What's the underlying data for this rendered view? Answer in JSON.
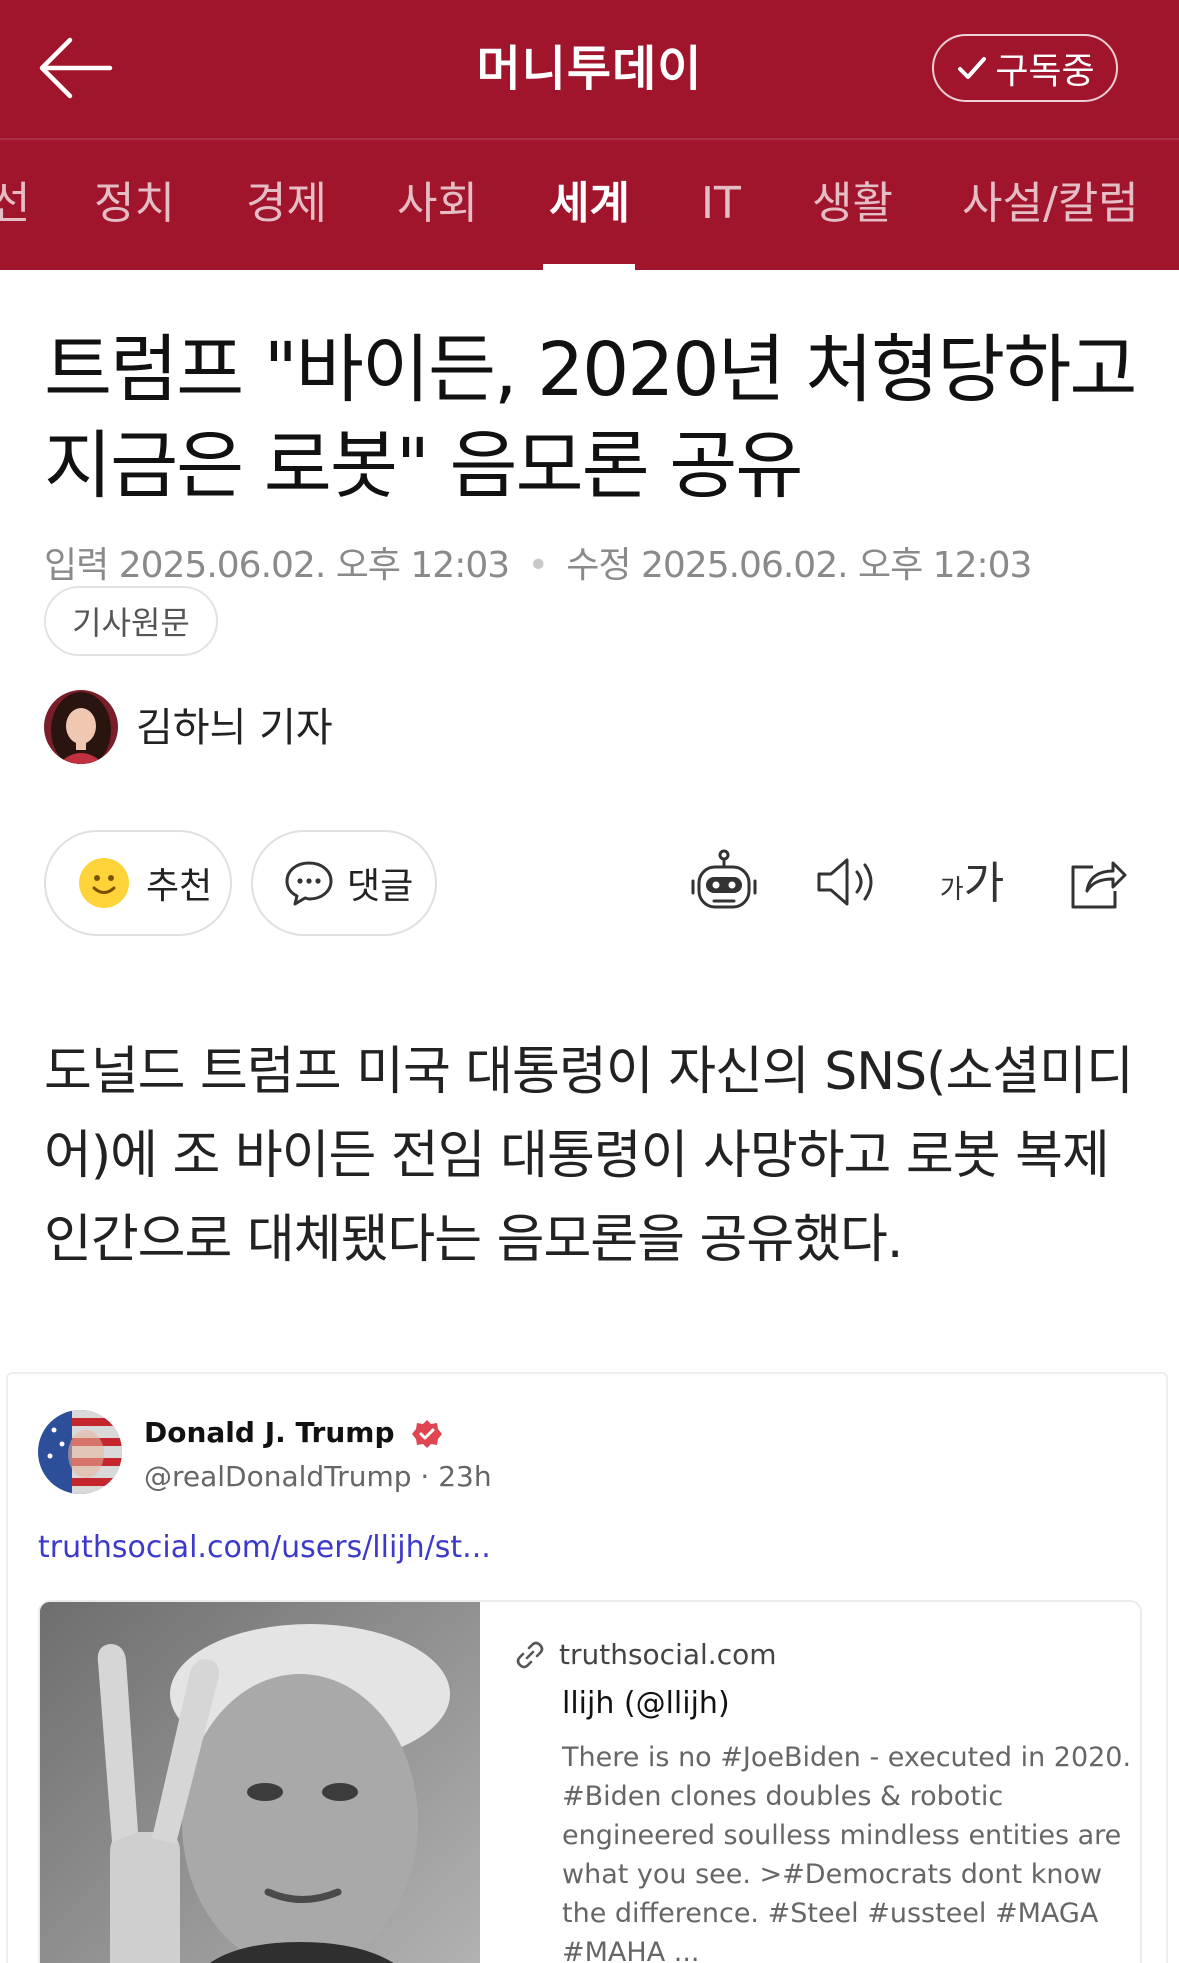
{
  "header": {
    "back_icon": "arrow-left-icon",
    "brand": "머니투데이",
    "subscribe_label": "구독중",
    "subscribe_icon": "check-icon",
    "brand_color": "#a0142c"
  },
  "tabs": [
    {
      "label": "선",
      "active": false
    },
    {
      "label": "정치",
      "active": false
    },
    {
      "label": "경제",
      "active": false
    },
    {
      "label": "사회",
      "active": false
    },
    {
      "label": "세계",
      "active": true
    },
    {
      "label": "IT",
      "active": false
    },
    {
      "label": "생활",
      "active": false
    },
    {
      "label": "사설/칼럼",
      "active": false
    }
  ],
  "article": {
    "headline": "트럼프 \"바이든, 2020년 처형당하고 지금은 로봇\" 음모론 공유",
    "input_label": "입력",
    "input_time": "2025.06.02. 오후 12:03",
    "edit_label": "수정",
    "edit_time": "2025.06.02. 오후 12:03",
    "original_button": "기사원문",
    "reporter": "김하늬 기자",
    "like_label": "추천",
    "comment_label": "댓글",
    "font_size_label_small": "가",
    "font_size_label_large": "가",
    "body": "도널드 트럼프 미국 대통령이 자신의 SNS(소셜미디어)에 조 바이든 전임 대통령이 사망하고 로봇 복제인간으로 대체됐다는 음모론을 공유했다."
  },
  "toolbar_icons": [
    "robot-summary-icon",
    "speaker-icon",
    "font-size-icon",
    "share-icon"
  ],
  "embed": {
    "author_name": "Donald J. Trump",
    "verified_color": "#e0464f",
    "handle": "@realDonaldTrump · 23h",
    "link_text": "truthsocial.com/users/llijh/st...",
    "card": {
      "domain": "truthsocial.com",
      "title": "llijh (@llijh)",
      "description": "There is no #JoeBiden - executed in 2020. #Biden clones doubles & robotic engineered soulless mindless entities are what you see. >#Democrats dont know the difference. #Steel #ussteel #MAGA #MAHA ..."
    }
  }
}
